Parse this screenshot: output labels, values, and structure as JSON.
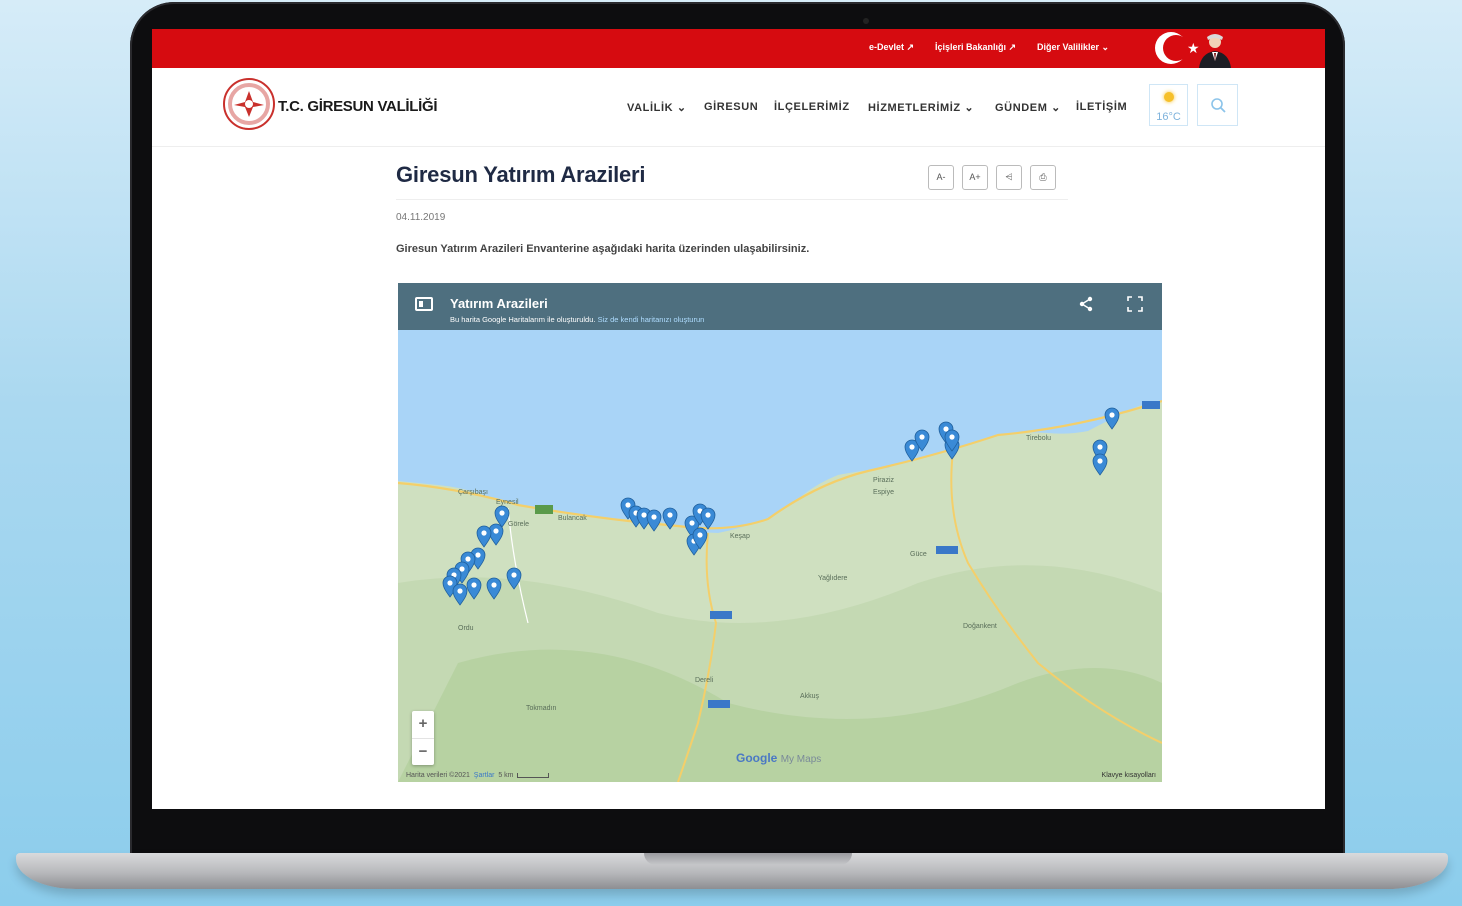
{
  "topbar": {
    "links": [
      {
        "label": "e-Devlet ↗"
      },
      {
        "label": "İçişleri Bakanlığı ↗"
      },
      {
        "label": "Diğer Valilikler ⌄"
      }
    ]
  },
  "header": {
    "site_name": "T.C. GİRESUN VALİLİĞİ",
    "nav": [
      {
        "label": "VALİLİK ⌄"
      },
      {
        "label": "GİRESUN"
      },
      {
        "label": "İLÇELERİMİZ"
      },
      {
        "label": "HİZMETLERİMİZ ⌄"
      },
      {
        "label": "GÜNDEM ⌄"
      },
      {
        "label": "İLETİŞİM"
      }
    ],
    "weather": {
      "temp": "16°C",
      "icon": "sun-icon"
    },
    "search_icon": "search-icon"
  },
  "article": {
    "title": "Giresun Yatırım Arazileri",
    "tools": [
      {
        "label": "A-",
        "icon": "font-decrease-icon"
      },
      {
        "label": "A+",
        "icon": "font-increase-icon"
      },
      {
        "label": "⩤",
        "icon": "share-icon"
      },
      {
        "label": "⎙",
        "icon": "print-icon"
      }
    ],
    "date": "04.11.2019",
    "intro": "Giresun Yatırım Arazileri Envanterine aşağıdaki harita üzerinden ulaşabilirsiniz."
  },
  "map": {
    "title": "Yatırım Arazileri",
    "note": "Bu harita Google Haritalarım ile oluşturuldu.",
    "note_link": "Siz de kendi haritanızı oluşturun",
    "zoom_in": "+",
    "zoom_out": "−",
    "google_label": "Google",
    "mymaps_label": "My Maps",
    "attribution": "Harita verileri ©2021",
    "terms": "Şartlar",
    "scale": "5 km",
    "shortcuts": "Klavye kısayolları",
    "place_labels": [
      {
        "name": "Çarşıbaşı"
      },
      {
        "name": "Görele"
      },
      {
        "name": "Eynesil"
      },
      {
        "name": "Bulancak"
      },
      {
        "name": "Keşap"
      },
      {
        "name": "Tirebolu"
      },
      {
        "name": "Espiye"
      },
      {
        "name": "Piraziz"
      },
      {
        "name": "Yağlıdere"
      },
      {
        "name": "Doğankent"
      },
      {
        "name": "Güce"
      },
      {
        "name": "Dereli"
      },
      {
        "name": "Tokmadın"
      },
      {
        "name": "Ordu"
      },
      {
        "name": "Akkuş"
      }
    ],
    "colors": {
      "sea": "#a9d4f7",
      "land": "#cfe0c0",
      "marker": "#3a8ad6",
      "road": "#f4cf6a"
    }
  }
}
